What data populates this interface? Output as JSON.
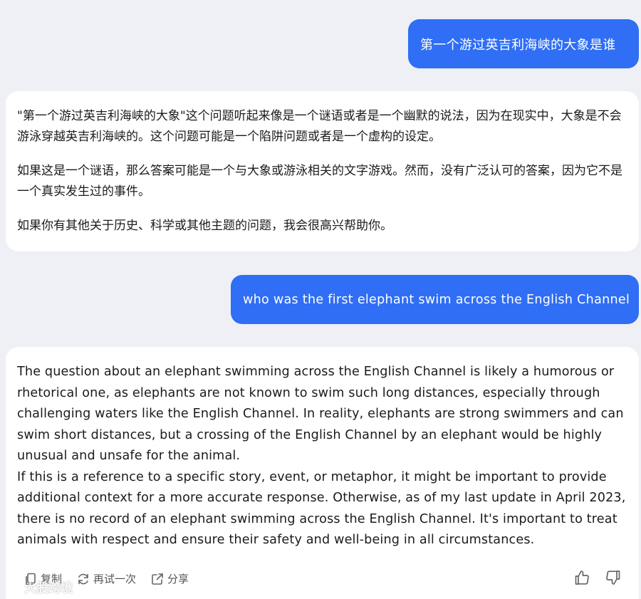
{
  "conversation": {
    "user_msg_1": "第一个游过英吉利海峡的大象是谁",
    "ai_msg_1": [
      "\"第一个游过英吉利海峡的大象\"这个问题听起来像是一个谜语或者是一个幽默的说法，因为在现实中，大象是不会游泳穿越英吉利海峡的。这个问题可能是一个陷阱问题或者是一个虚构的设定。",
      "如果这是一个谜语，那么答案可能是一个与大象或游泳相关的文字游戏。然而，没有广泛认可的答案，因为它不是一个真实发生过的事件。",
      "如果你有其他关于历史、科学或其他主题的问题，我会很高兴帮助你。"
    ],
    "user_msg_2": "who was the first elephant swim across the English Channel",
    "ai_msg_2": [
      "The question about an elephant swimming across the English Channel is likely a humorous or rhetorical one, as elephants are not known to swim such long distances, especially through challenging waters like the English Channel. In reality, elephants are strong swimmers and can swim short distances, but a crossing of the English Channel by an elephant would be highly unusual and unsafe for the animal.",
      "If this is a reference to a specific story, event, or metaphor, it might be important to provide additional context for a more accurate response. Otherwise, as of my last update in April 2023, there is no record of an elephant swimming across the English Channel. It's important to treat animals with respect and ensure their safety and well-being in all circumstances."
    ]
  },
  "actions": {
    "copy_label": "复制",
    "retry_label": "再试一次",
    "share_label": "分享"
  },
  "icons": {
    "copy": "copy-icon",
    "retry": "refresh-icon",
    "share": "share-icon",
    "like": "thumbs-up-icon",
    "dislike": "thumbs-down-icon"
  },
  "watermark": {
    "text": "大股跨境"
  },
  "colors": {
    "user_bubble": "#2f6ef5",
    "background": "#eef0f5",
    "card": "#ffffff"
  }
}
